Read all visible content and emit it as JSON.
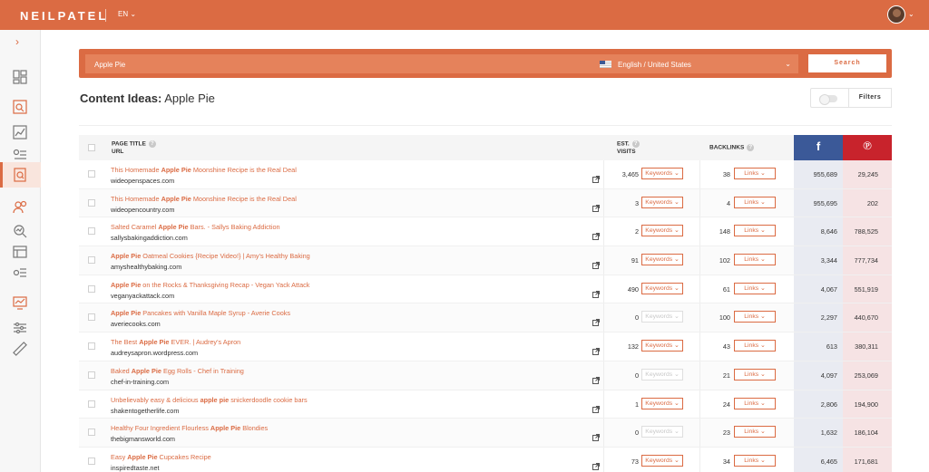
{
  "brand": {
    "logo": "NEILPATEL",
    "lang": "EN"
  },
  "search": {
    "query": "Apple Pie",
    "language": "English / United States",
    "button": "Search"
  },
  "heading": {
    "prefix": "Content Ideas:",
    "term": "Apple Pie"
  },
  "filters_label": "Filters",
  "columns": {
    "page_title": "PAGE TITLE",
    "url": "URL",
    "est": "EST.",
    "visits": "VISITS",
    "backlinks": "BACKLINKS",
    "facebook_icon": "facebook-icon",
    "pinterest_icon": "pinterest-icon"
  },
  "colors": {
    "accent": "#db6b43",
    "facebook": "#3b5998",
    "pinterest": "#c8232c"
  },
  "rows": [
    {
      "t1": "This Homemade ",
      "tb": "Apple Pie",
      "t2": " Moonshine Recipe is the Real Deal",
      "url": "wideopenspaces.com",
      "visits": "3,465",
      "kw": "Keywords",
      "kw_disabled": false,
      "backlinks": "38",
      "links": "Links",
      "fb": "955,689",
      "pin": "29,245"
    },
    {
      "t1": "This Homemade ",
      "tb": "Apple Pie",
      "t2": " Moonshine Recipe is the Real Deal",
      "url": "wideopencountry.com",
      "visits": "3",
      "kw": "Keywords",
      "kw_disabled": false,
      "backlinks": "4",
      "links": "Links",
      "fb": "955,695",
      "pin": "202"
    },
    {
      "t1": "Salted Caramel ",
      "tb": "Apple Pie",
      "t2": " Bars. - Sallys Baking Addiction",
      "url": "sallysbakingaddiction.com",
      "visits": "2",
      "kw": "Keywords",
      "kw_disabled": false,
      "backlinks": "148",
      "links": "Links",
      "fb": "8,646",
      "pin": "788,525"
    },
    {
      "t1": "",
      "tb": "Apple Pie",
      "t2": " Oatmeal Cookies {Recipe Video!} | Amy's Healthy Baking",
      "url": "amyshealthybaking.com",
      "visits": "91",
      "kw": "Keywords",
      "kw_disabled": false,
      "backlinks": "102",
      "links": "Links",
      "fb": "3,344",
      "pin": "777,734"
    },
    {
      "t1": "",
      "tb": "Apple Pie",
      "t2": " on the Rocks & Thanksgiving Recap - Vegan Yack Attack",
      "url": "veganyackattack.com",
      "visits": "490",
      "kw": "Keywords",
      "kw_disabled": false,
      "backlinks": "61",
      "links": "Links",
      "fb": "4,067",
      "pin": "551,919"
    },
    {
      "t1": "",
      "tb": "Apple Pie",
      "t2": " Pancakes with Vanilla Maple Syrup - Averie Cooks",
      "url": "averiecooks.com",
      "visits": "0",
      "kw": "Keywords",
      "kw_disabled": true,
      "backlinks": "100",
      "links": "Links",
      "fb": "2,297",
      "pin": "440,670"
    },
    {
      "t1": "The Best ",
      "tb": "Apple Pie",
      "t2": " EVER. | Audrey's Apron",
      "url": "audreysapron.wordpress.com",
      "visits": "132",
      "kw": "Keywords",
      "kw_disabled": false,
      "backlinks": "43",
      "links": "Links",
      "fb": "613",
      "pin": "380,311"
    },
    {
      "t1": "Baked ",
      "tb": "Apple Pie",
      "t2": " Egg Rolls - Chef in Training",
      "url": "chef-in-training.com",
      "visits": "0",
      "kw": "Keywords",
      "kw_disabled": true,
      "backlinks": "21",
      "links": "Links",
      "fb": "4,097",
      "pin": "253,069"
    },
    {
      "t1": "Unbelievably easy & delicious ",
      "tb": "apple pie",
      "t2": " snickerdoodle cookie bars",
      "url": "shakentogetherlife.com",
      "visits": "1",
      "kw": "Keywords",
      "kw_disabled": false,
      "backlinks": "24",
      "links": "Links",
      "fb": "2,806",
      "pin": "194,900"
    },
    {
      "t1": "Healthy Four Ingredient Flourless ",
      "tb": "Apple Pie",
      "t2": " Blondies",
      "url": "thebigmansworld.com",
      "visits": "0",
      "kw": "Keywords",
      "kw_disabled": true,
      "backlinks": "23",
      "links": "Links",
      "fb": "1,632",
      "pin": "186,104"
    },
    {
      "t1": "Easy ",
      "tb": "Apple Pie",
      "t2": " Cupcakes Recipe",
      "url": "inspiredtaste.net",
      "visits": "73",
      "kw": "Keywords",
      "kw_disabled": false,
      "backlinks": "34",
      "links": "Links",
      "fb": "6,465",
      "pin": "171,681"
    }
  ]
}
